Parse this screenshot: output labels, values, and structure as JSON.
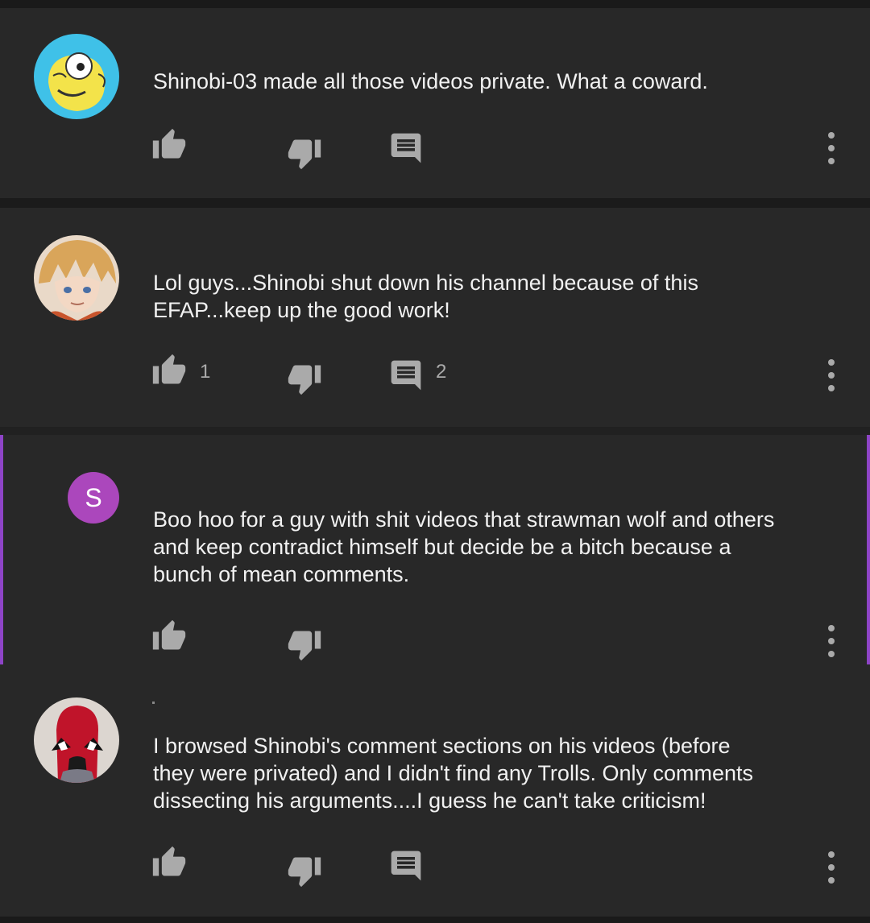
{
  "comments": [
    {
      "avatar": "cartoon-face-avatar",
      "text": "Shinobi-03 made all those videos private. What a coward.",
      "likes": "",
      "replies": ""
    },
    {
      "avatar": "anime-character-avatar",
      "text": "Lol guys...Shinobi shut down his channel because of this\nEFAP...keep up the good work!",
      "likes": "1",
      "replies": "2"
    },
    {
      "avatar": "letter-avatar",
      "avatar_letter": "S",
      "text": "Boo hoo for a guy with shit videos that strawman wolf and others\nand keep contradict himself but decide be a bitch because a\nbunch of mean comments.",
      "likes": "",
      "replies": ""
    },
    {
      "avatar": "masked-character-avatar",
      "text": "I browsed Shinobi's comment sections on his videos (before\nthey were privated) and I didn't find any Trolls. Only comments\ndissecting his arguments....I guess he can't take criticism!",
      "likes": "",
      "replies": ""
    }
  ],
  "colors": {
    "background": "#212121",
    "card": "#282828",
    "text": "#f1f1f1",
    "icon": "#aaaaaa",
    "accent_reply": "#8e44c7",
    "letter_avatar": "#ab47bc"
  },
  "icons": {
    "like": "thumbs-up-icon",
    "dislike": "thumbs-down-icon",
    "reply": "comment-icon",
    "more": "more-vert-icon"
  }
}
